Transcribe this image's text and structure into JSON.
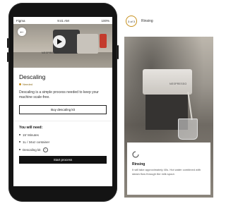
{
  "phone": {
    "statusbar": {
      "carrier": "Figma",
      "time": "9:41 AM",
      "battery": "100%"
    },
    "hero": {
      "brand_text": "NESPRESSO"
    },
    "title": "Descaling",
    "status_label": "Needed",
    "description": "Descaling is a simple process needed to keep your machine scale-free.",
    "buy_button": "Buy descaling kit",
    "need_title": "You will need:",
    "needs": [
      "15' Minutes",
      "1L / 34oz container",
      "Descaling kit"
    ],
    "start_button": "Start process",
    "colors": {
      "accent": "#c7901d",
      "button_dark": "#111111"
    }
  },
  "right": {
    "step_counter": "3 of 3",
    "step_label": "Rinsing",
    "photo_brand_text": "NESPRESSO",
    "card": {
      "title": "Rinsing",
      "description": "It will take approximately 40s. Hot water combined with steam flow through the milk spout."
    }
  }
}
